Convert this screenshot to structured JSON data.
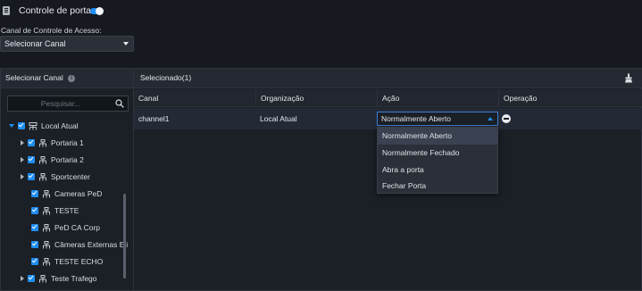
{
  "header": {
    "title": "Controle de porta",
    "toggle_on": true,
    "access_channel_label": "Canal de Controle de Acesso:",
    "channel_select_value": "Selecionar Canal"
  },
  "left_panel": {
    "title": "Selecionar Canal",
    "info_icon": "i",
    "search_placeholder": "Pesquisar...",
    "tree": [
      {
        "label": "Local Atual",
        "expanded": true,
        "checked": true,
        "level": 0
      },
      {
        "label": "Portaria 1",
        "expanded": false,
        "checked": true,
        "level": 1
      },
      {
        "label": "Portaria 2",
        "expanded": false,
        "checked": true,
        "level": 1
      },
      {
        "label": "Sportcenter",
        "expanded": false,
        "checked": true,
        "level": 1
      },
      {
        "label": "Cameras PeD",
        "checked": true,
        "level": 1
      },
      {
        "label": "TESTE",
        "checked": true,
        "level": 1
      },
      {
        "label": "PeD CA Corp",
        "checked": true,
        "level": 1
      },
      {
        "label": "Câmeras Externas Eli",
        "checked": true,
        "level": 1
      },
      {
        "label": "TESTE ECHO",
        "checked": true,
        "level": 1
      },
      {
        "label": "Teste Trafego",
        "expanded": false,
        "checked": true,
        "level": 1
      }
    ]
  },
  "right_panel": {
    "title": "Selecionado(1)",
    "columns": [
      "Canal",
      "Organização",
      "Ação",
      "Operação"
    ],
    "rows": [
      {
        "canal": "channel1",
        "organizacao": "Local Atual",
        "acao": "Normalmente Aberto"
      }
    ],
    "action_options": [
      "Normalmente Aberto",
      "Normalmente Fechado",
      "Abra a porta",
      "Fechar Porta"
    ],
    "selected_option": "Normalmente Aberto"
  },
  "colors": {
    "accent": "#1e8df2",
    "background": "#16191f",
    "panel": "#1b1f26",
    "header_bar": "#252a32"
  }
}
